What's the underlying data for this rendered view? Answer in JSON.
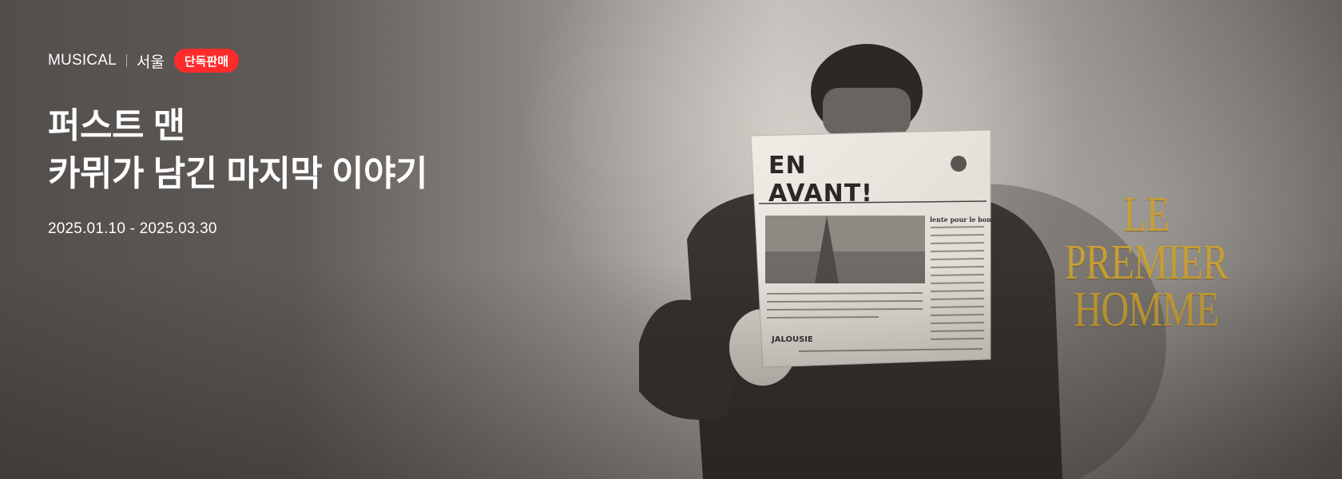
{
  "banner": {
    "genre": "MUSICAL",
    "region": "서울",
    "badge": "단독판매",
    "title_line1": "퍼스트 맨",
    "title_line2": "카뮈가 남긴 마지막 이야기",
    "dates": "2025.01.10 - 2025.03.30"
  },
  "artwork": {
    "newspaper_masthead": "EN AVANT!",
    "newspaper_column_head": "lente pour le bonheur",
    "newspaper_headline2": "JALOUSIE",
    "title_line1": "LE PREMIER",
    "title_line2": "HOMME"
  },
  "colors": {
    "badge": "#ff2b2b",
    "title_art_gold": "#c9a032",
    "text": "#ffffff"
  }
}
